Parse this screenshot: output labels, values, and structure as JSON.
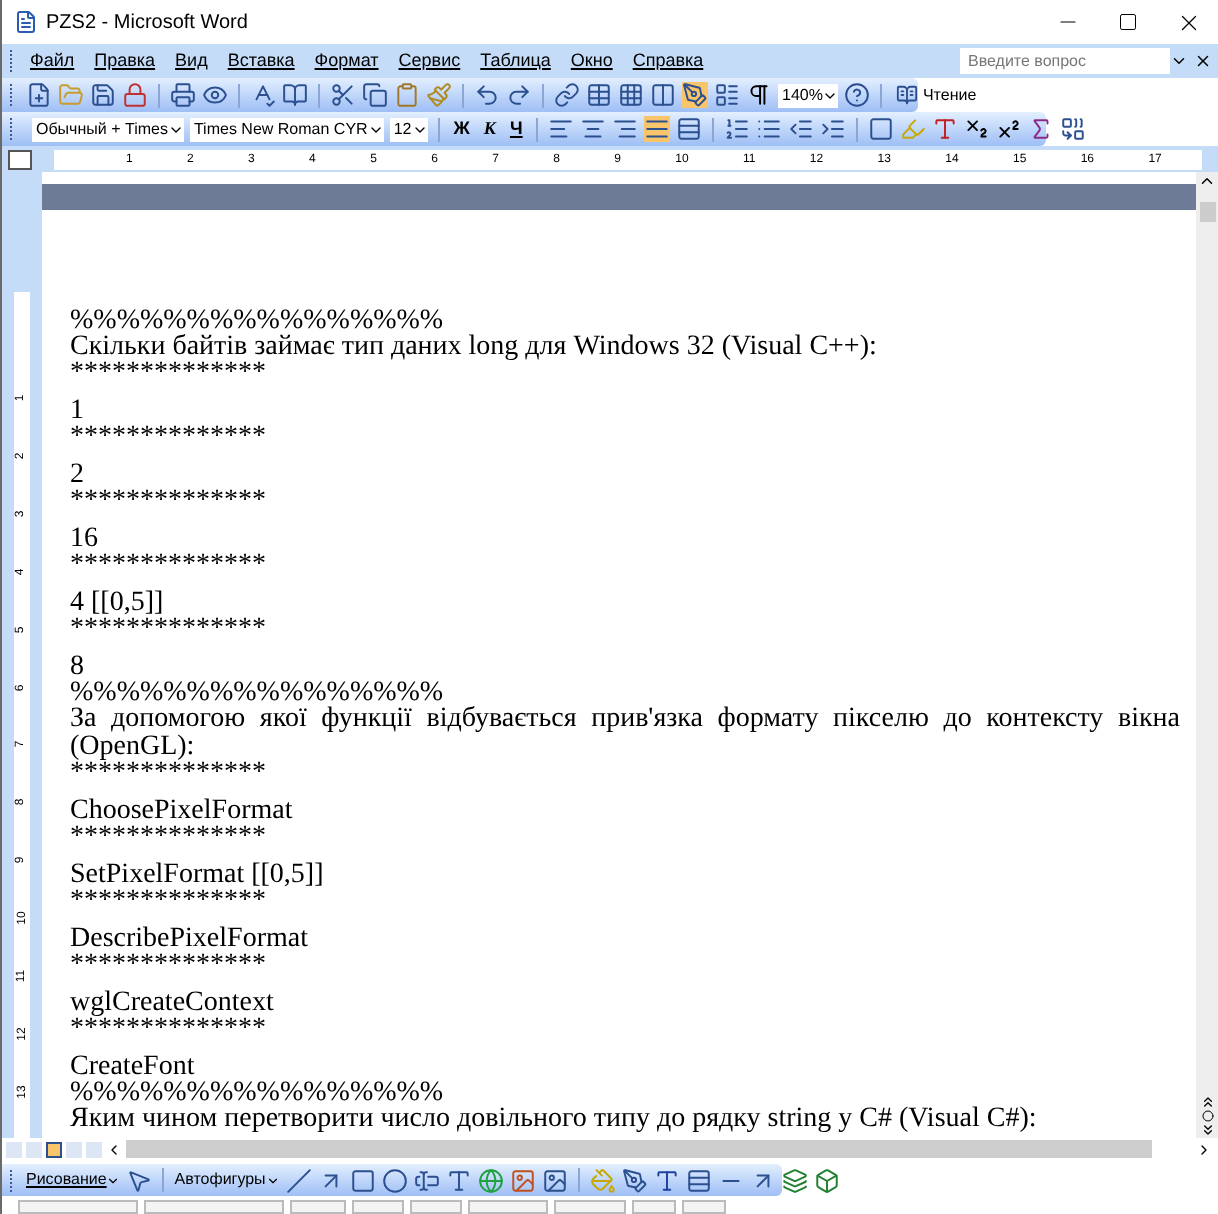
{
  "window": {
    "title": "PZS2 - Microsoft Word"
  },
  "menu": [
    "Файл",
    "Правка",
    "Вид",
    "Вставка",
    "Формат",
    "Сервис",
    "Таблица",
    "Окно",
    "Справка"
  ],
  "help_search": {
    "placeholder": "Введите вопрос"
  },
  "standard_toolbar": {
    "zoom": "140%",
    "reading_button": "Чтение"
  },
  "formatting_toolbar": {
    "style": "Обычный + Times",
    "font": "Times New Roman CYR",
    "size": "12",
    "bold": "Ж",
    "italic": "К",
    "underline": "Ч",
    "justify_selected": true
  },
  "ruler": {
    "numbers": [
      "1",
      "2",
      "3",
      "4",
      "5",
      "6",
      "7",
      "8",
      "9",
      "10",
      "11",
      "12",
      "13",
      "14",
      "15",
      "16",
      "17"
    ]
  },
  "vertical_ruler": {
    "numbers": [
      "1",
      "2",
      "3",
      "4",
      "5",
      "6",
      "7",
      "8",
      "9",
      "10",
      "11",
      "12",
      "13"
    ]
  },
  "document": {
    "paragraphs": [
      {
        "kind": "rule",
        "text": "%%%%%%%%%%%%%%%%"
      },
      {
        "kind": "question",
        "text": "Скільки байтів займає тип даних long для Windows 32 (Visual C++):"
      },
      {
        "kind": "rule",
        "text": "**************"
      },
      {
        "kind": "answer",
        "text": "1"
      },
      {
        "kind": "rule",
        "text": "**************"
      },
      {
        "kind": "answer",
        "text": "2"
      },
      {
        "kind": "rule",
        "text": "**************"
      },
      {
        "kind": "answer",
        "text": "16"
      },
      {
        "kind": "rule",
        "text": "**************"
      },
      {
        "kind": "answer",
        "text": "4 [[0,5]]"
      },
      {
        "kind": "rule",
        "text": "**************"
      },
      {
        "kind": "answer",
        "text": "8"
      },
      {
        "kind": "rule",
        "text": "%%%%%%%%%%%%%%%%"
      },
      {
        "kind": "question",
        "text": "За допомогою якої функції відбувається прив'язка формату пікселю до контексту вікна (OpenGL):"
      },
      {
        "kind": "rule",
        "text": "**************"
      },
      {
        "kind": "answer",
        "text": "ChoosePixelFormat"
      },
      {
        "kind": "rule",
        "text": "**************"
      },
      {
        "kind": "answer",
        "text": "SetPixelFormat [[0,5]]"
      },
      {
        "kind": "rule",
        "text": "**************"
      },
      {
        "kind": "answer",
        "text": "DescribePixelFormat"
      },
      {
        "kind": "rule",
        "text": "**************"
      },
      {
        "kind": "answer",
        "text": "wglCreateContext"
      },
      {
        "kind": "rule",
        "text": "**************"
      },
      {
        "kind": "answer",
        "text": "CreateFont"
      },
      {
        "kind": "rule",
        "text": "%%%%%%%%%%%%%%%%"
      },
      {
        "kind": "question",
        "text": "Яким чином перетворити число довільного типу до рядку string у C# (Visual C#):"
      }
    ]
  },
  "view_buttons": [
    {
      "selected": false
    },
    {
      "selected": false
    },
    {
      "selected": true
    },
    {
      "selected": false
    },
    {
      "selected": false
    }
  ],
  "drawing_toolbar": {
    "draw_menu": "Рисование",
    "autoshapes_menu": "Автофигуры"
  }
}
